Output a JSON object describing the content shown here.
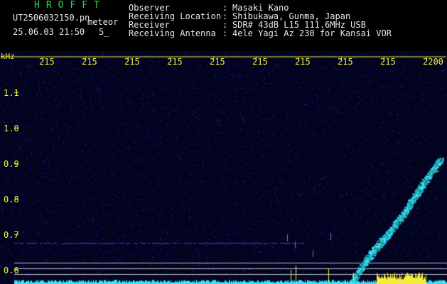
{
  "header": {
    "app_title": "HROFFT",
    "file_name": "UT2506032150.pn",
    "mode": "meteor",
    "datetime": "25.06.03 21:50",
    "count": "5_"
  },
  "metadata": {
    "observer_label": "Observer",
    "observer_value": "Masaki Kano",
    "location_label": "Receiving Location",
    "location_value": "Shibukawa, Gunma, Japan",
    "receiver_label": "Receiver",
    "receiver_value": "SDR# 43dB L15 111.6MHz USB",
    "antenna_label": "Receiving Antenna",
    "antenna_value": "4ele Yagi Az 230 for Kansai VOR",
    "separator": ":"
  },
  "plot": {
    "y_unit": "kHz",
    "y_ticks": [
      "1.1",
      "1.0",
      "0.9",
      "0.8",
      "0.7",
      "0.6"
    ],
    "time_labels": [
      "215",
      "215",
      "215",
      "215",
      "215",
      "215",
      "215",
      "215",
      "215",
      "2200"
    ],
    "colors": {
      "background": "#02031e",
      "noise": "#1d2a9a",
      "signal": "#34e3ff",
      "axis": "#f2ee3a",
      "grid": "#c8c8c8"
    }
  }
}
